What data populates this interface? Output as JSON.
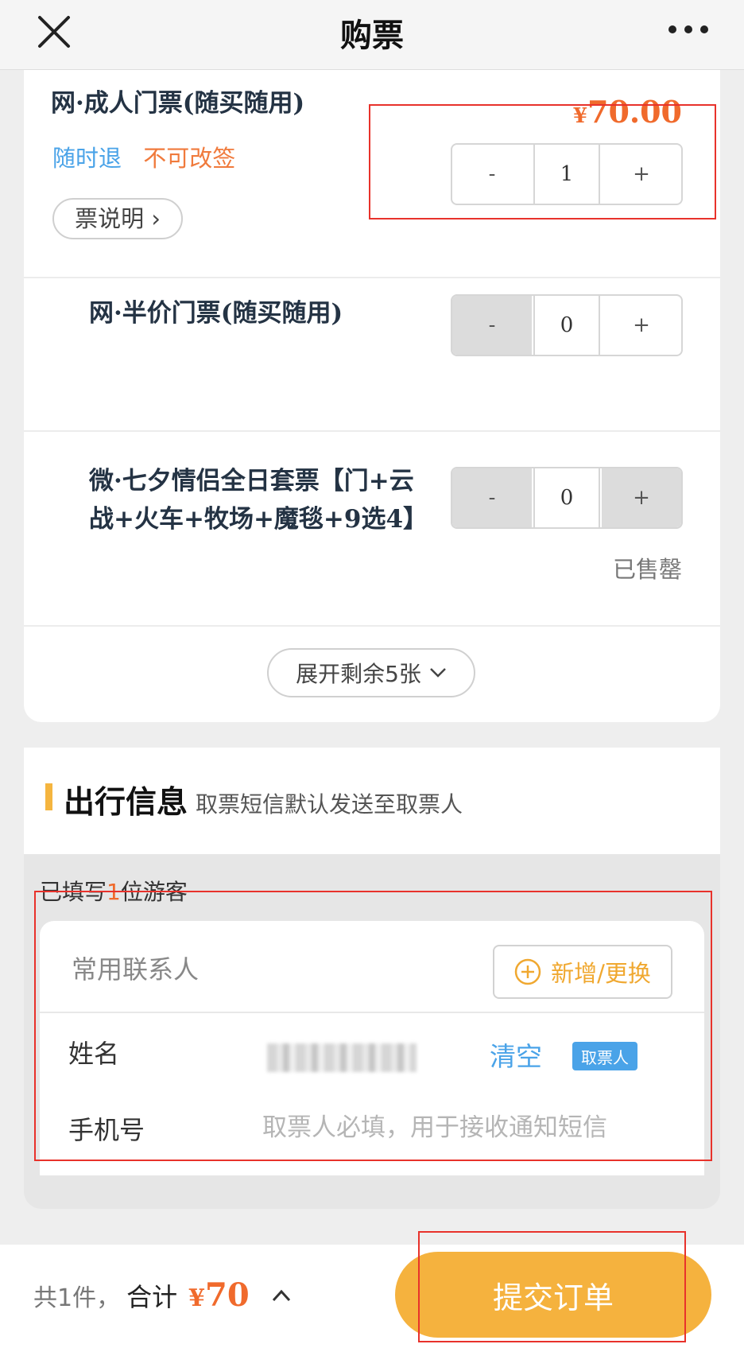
{
  "header": {
    "title": "购票",
    "close_icon": "close-icon",
    "more_icon": "more-icon"
  },
  "tickets": [
    {
      "name": "网·成人门票(随买随用)",
      "tag_refund": "随时退",
      "tag_change": "不可改签",
      "desc_label": "票说明",
      "price_symbol": "¥",
      "price": "70.00",
      "minus": "-",
      "quantity": "1",
      "plus": "+"
    },
    {
      "name": "网·半价门票(随买随用)",
      "minus": "-",
      "quantity": "0",
      "plus": "+"
    },
    {
      "name_line1": "微·七夕情侣全日套票【门+云",
      "name_line2": "战+火车+牧场+魔毯+9选4】",
      "minus": "-",
      "quantity": "0",
      "plus": "+",
      "status": "已售罄"
    }
  ],
  "expand_label": "展开剩余5张",
  "travel": {
    "title": "出行信息",
    "subtitle": "取票短信默认发送至取票人",
    "filled_prefix": "已填写",
    "filled_count": "1",
    "filled_suffix": "位游客",
    "frequent_label": "常用联系人",
    "add_label": "新增/更换",
    "name_label": "姓名",
    "clear_label": "清空",
    "picker_badge": "取票人",
    "phone_label": "手机号",
    "phone_placeholder": "取票人必填，用于接收通知短信"
  },
  "footer": {
    "count_text": "共1件，",
    "total_label": "合计",
    "total_symbol": "¥",
    "total_value": "70",
    "submit_label": "提交订单"
  },
  "colors": {
    "accent_orange": "#f06a2c",
    "accent_blue": "#4aa3e8",
    "button_yellow": "#f5b23e",
    "annotation_red": "#e8322b"
  }
}
